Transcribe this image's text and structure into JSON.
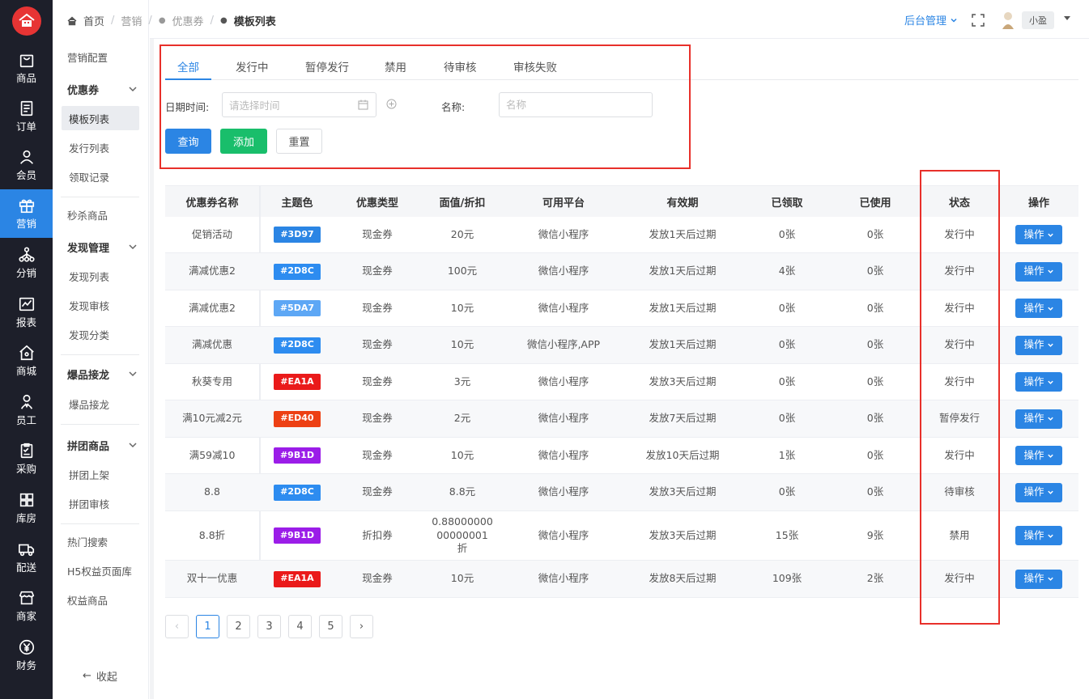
{
  "sidebar": {
    "items": [
      {
        "label": "商品",
        "icon": "shopping-bag-icon"
      },
      {
        "label": "订单",
        "icon": "order-list-icon"
      },
      {
        "label": "会员",
        "icon": "user-icon"
      },
      {
        "label": "营销",
        "icon": "gift-icon",
        "active": true
      },
      {
        "label": "分销",
        "icon": "network-icon"
      },
      {
        "label": "报表",
        "icon": "chart-icon"
      },
      {
        "label": "商城",
        "icon": "home-icon"
      },
      {
        "label": "员工",
        "icon": "staff-icon"
      },
      {
        "label": "采购",
        "icon": "clipboard-icon"
      },
      {
        "label": "库房",
        "icon": "warehouse-icon"
      },
      {
        "label": "配送",
        "icon": "truck-icon"
      },
      {
        "label": "商家",
        "icon": "store-icon"
      },
      {
        "label": "财务",
        "icon": "yuan-icon"
      }
    ]
  },
  "submenu": {
    "marketing_config": "营销配置",
    "coupon_group": "优惠券",
    "template_list": "模板列表",
    "issue_list": "发行列表",
    "claim_records": "领取记录",
    "flash_sale": "秒杀商品",
    "discover_group": "发现管理",
    "discover_list": "发现列表",
    "discover_review": "发现审核",
    "discover_category": "发现分类",
    "hot_group": "爆品接龙",
    "hot_item": "爆品接龙",
    "group_buy_group": "拼团商品",
    "group_buy_listing": "拼团上架",
    "group_buy_review": "拼团审核",
    "hot_search": "热门搜索",
    "h5_pages": "H5权益页面库",
    "benefit_goods": "权益商品",
    "collapse": "收起"
  },
  "breadcrumb": {
    "home": "首页",
    "marketing": "营销",
    "coupon": "优惠券",
    "current": "模板列表"
  },
  "header": {
    "admin": "后台管理",
    "user": "小盈"
  },
  "tabs": [
    "全部",
    "发行中",
    "暂停发行",
    "禁用",
    "待审核",
    "审核失败"
  ],
  "filter": {
    "date_label": "日期时间:",
    "date_placeholder": "请选择时间",
    "name_label": "名称:",
    "name_placeholder": "名称",
    "query": "查询",
    "add": "添加",
    "reset": "重置"
  },
  "table": {
    "headers": [
      "优惠券名称",
      "主题色",
      "优惠类型",
      "面值/折扣",
      "可用平台",
      "有效期",
      "已领取",
      "已使用",
      "状态",
      "操作"
    ],
    "op_label": "操作",
    "rows": [
      {
        "name": "促销活动",
        "color": "#3D97",
        "color_hex": "#2b85e4",
        "type": "现金券",
        "value": "20元",
        "platform": "微信小程序",
        "validity": "发放1天后过期",
        "claimed": "0张",
        "used": "0张",
        "status": "发行中"
      },
      {
        "name": "满减优惠2",
        "color": "#2D8C",
        "color_hex": "#2d8cf0",
        "type": "现金券",
        "value": "100元",
        "platform": "微信小程序",
        "validity": "发放1天后过期",
        "claimed": "4张",
        "used": "0张",
        "status": "发行中"
      },
      {
        "name": "满减优惠2",
        "color": "#5DA7",
        "color_hex": "#5da7f5",
        "type": "现金券",
        "value": "10元",
        "platform": "微信小程序",
        "validity": "发放1天后过期",
        "claimed": "0张",
        "used": "0张",
        "status": "发行中"
      },
      {
        "name": "满减优惠",
        "color": "#2D8C",
        "color_hex": "#2d8cf0",
        "type": "现金券",
        "value": "10元",
        "platform": "微信小程序,APP",
        "validity": "发放1天后过期",
        "claimed": "0张",
        "used": "0张",
        "status": "发行中"
      },
      {
        "name": "秋葵专用",
        "color": "#EA1A",
        "color_hex": "#ea1a1a",
        "type": "现金券",
        "value": "3元",
        "platform": "微信小程序",
        "validity": "发放3天后过期",
        "claimed": "0张",
        "used": "0张",
        "status": "发行中"
      },
      {
        "name": "满10元减2元",
        "color": "#ED40",
        "color_hex": "#ed4014",
        "type": "现金券",
        "value": "2元",
        "platform": "微信小程序",
        "validity": "发放7天后过期",
        "claimed": "0张",
        "used": "0张",
        "status": "暂停发行"
      },
      {
        "name": "满59减10",
        "color": "#9B1D",
        "color_hex": "#9b1de8",
        "type": "现金券",
        "value": "10元",
        "platform": "微信小程序",
        "validity": "发放10天后过期",
        "claimed": "1张",
        "used": "0张",
        "status": "发行中"
      },
      {
        "name": "8.8",
        "color": "#2D8C",
        "color_hex": "#2d8cf0",
        "type": "现金券",
        "value": "8.8元",
        "platform": "微信小程序",
        "validity": "发放3天后过期",
        "claimed": "0张",
        "used": "0张",
        "status": "待审核"
      },
      {
        "name": "8.8折",
        "color": "#9B1D",
        "color_hex": "#9b1de8",
        "type": "折扣券",
        "value": "0.88000000\n00000001\n折",
        "platform": "微信小程序",
        "validity": "发放3天后过期",
        "claimed": "15张",
        "used": "9张",
        "status": "禁用"
      },
      {
        "name": "双十一优惠",
        "color": "#EA1A",
        "color_hex": "#ea1a1a",
        "type": "现金券",
        "value": "10元",
        "platform": "微信小程序",
        "validity": "发放8天后过期",
        "claimed": "109张",
        "used": "2张",
        "status": "发行中"
      }
    ]
  },
  "pagination": {
    "pages": [
      "1",
      "2",
      "3",
      "4",
      "5"
    ],
    "current": "1",
    "prev": "‹",
    "next": "›"
  },
  "colors": {
    "primary": "#2b85e4",
    "success": "#19be6b",
    "highlight": "#e8302a",
    "rail": "#1d1f2a"
  }
}
